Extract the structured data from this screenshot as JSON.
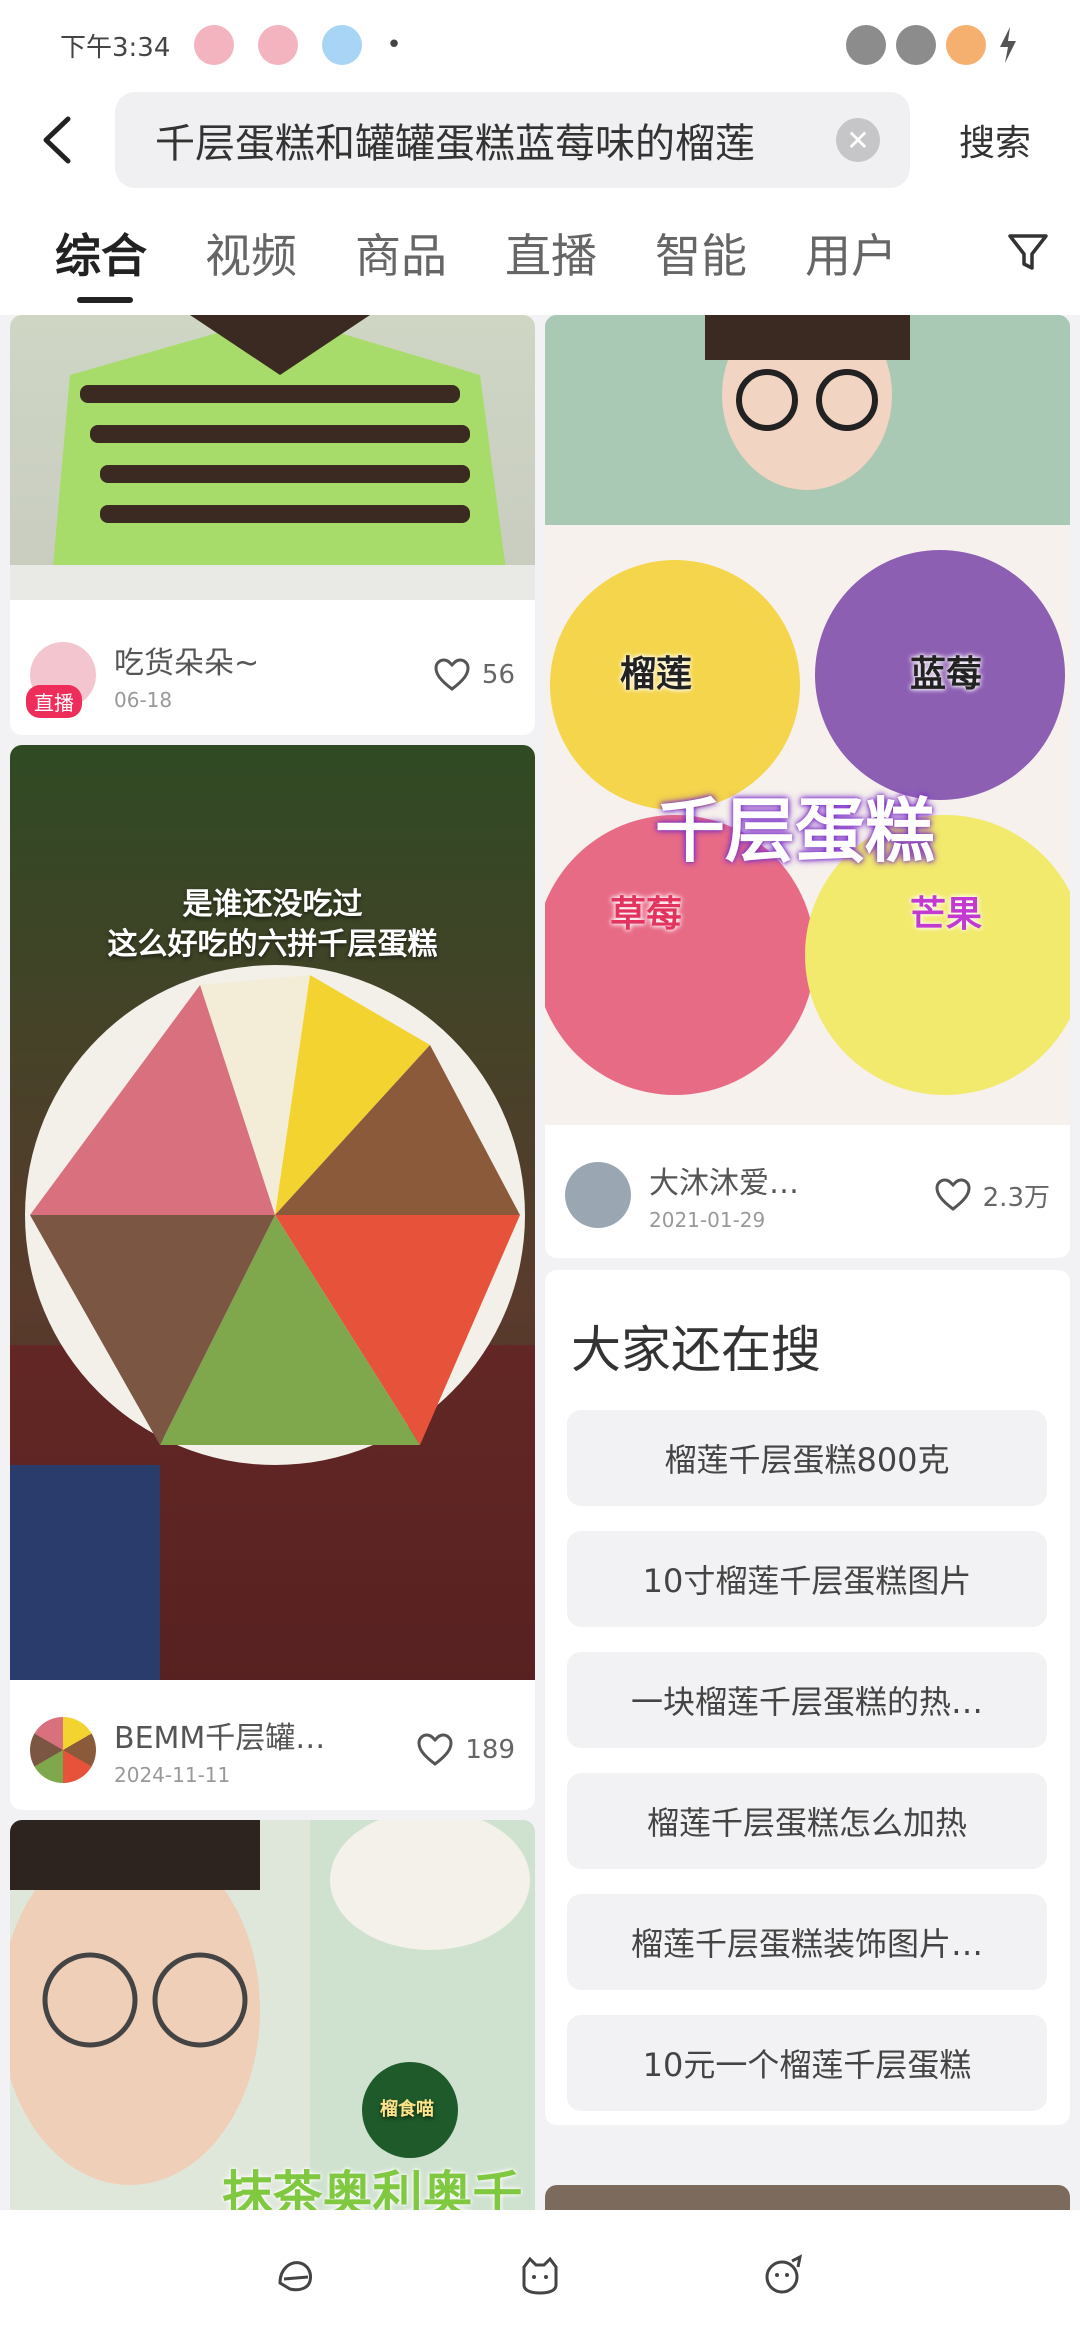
{
  "status_bar": {
    "time": "下午3:34",
    "dot": "•"
  },
  "search": {
    "query": "千层蛋糕和罐罐蛋糕蓝莓味的榴莲",
    "button_label": "搜索",
    "clear_glyph": "✕"
  },
  "tabs": [
    {
      "label": "综合",
      "active": true
    },
    {
      "label": "视频"
    },
    {
      "label": "商品"
    },
    {
      "label": "直播"
    },
    {
      "label": "智能"
    },
    {
      "label": "用户"
    }
  ],
  "cards": {
    "card1": {
      "author": "吃货朵朵~",
      "date": "06-18",
      "likes": "56",
      "live_badge": "直播"
    },
    "card2": {
      "author": "大沐沐爱…",
      "date": "2021-01-29",
      "likes": "2.3万",
      "overlay_title": "千层蛋糕",
      "flavors": [
        "榴莲",
        "蓝莓",
        "草莓",
        "芒果"
      ]
    },
    "card3": {
      "author": "BEMM千层罐…",
      "date": "2024-11-11",
      "likes": "189",
      "overlay_line1": "是谁还没吃过",
      "overlay_line2": "这么好吃的六拼千层蛋糕"
    },
    "card4": {
      "overlay_text": "抹茶奥利奥千层",
      "badge_text": "榴食喵"
    }
  },
  "suggestions": {
    "title": "大家还在搜",
    "items": [
      "榴莲千层蛋糕800克",
      "10寸榴莲千层蛋糕图片",
      "一块榴莲千层蛋糕的热…",
      "榴莲千层蛋糕怎么加热",
      "榴莲千层蛋糕装饰图片…",
      "10元一个榴莲千层蛋糕"
    ]
  },
  "colors": {
    "accent": "#ee2d5a",
    "tab_active": "#222222"
  }
}
